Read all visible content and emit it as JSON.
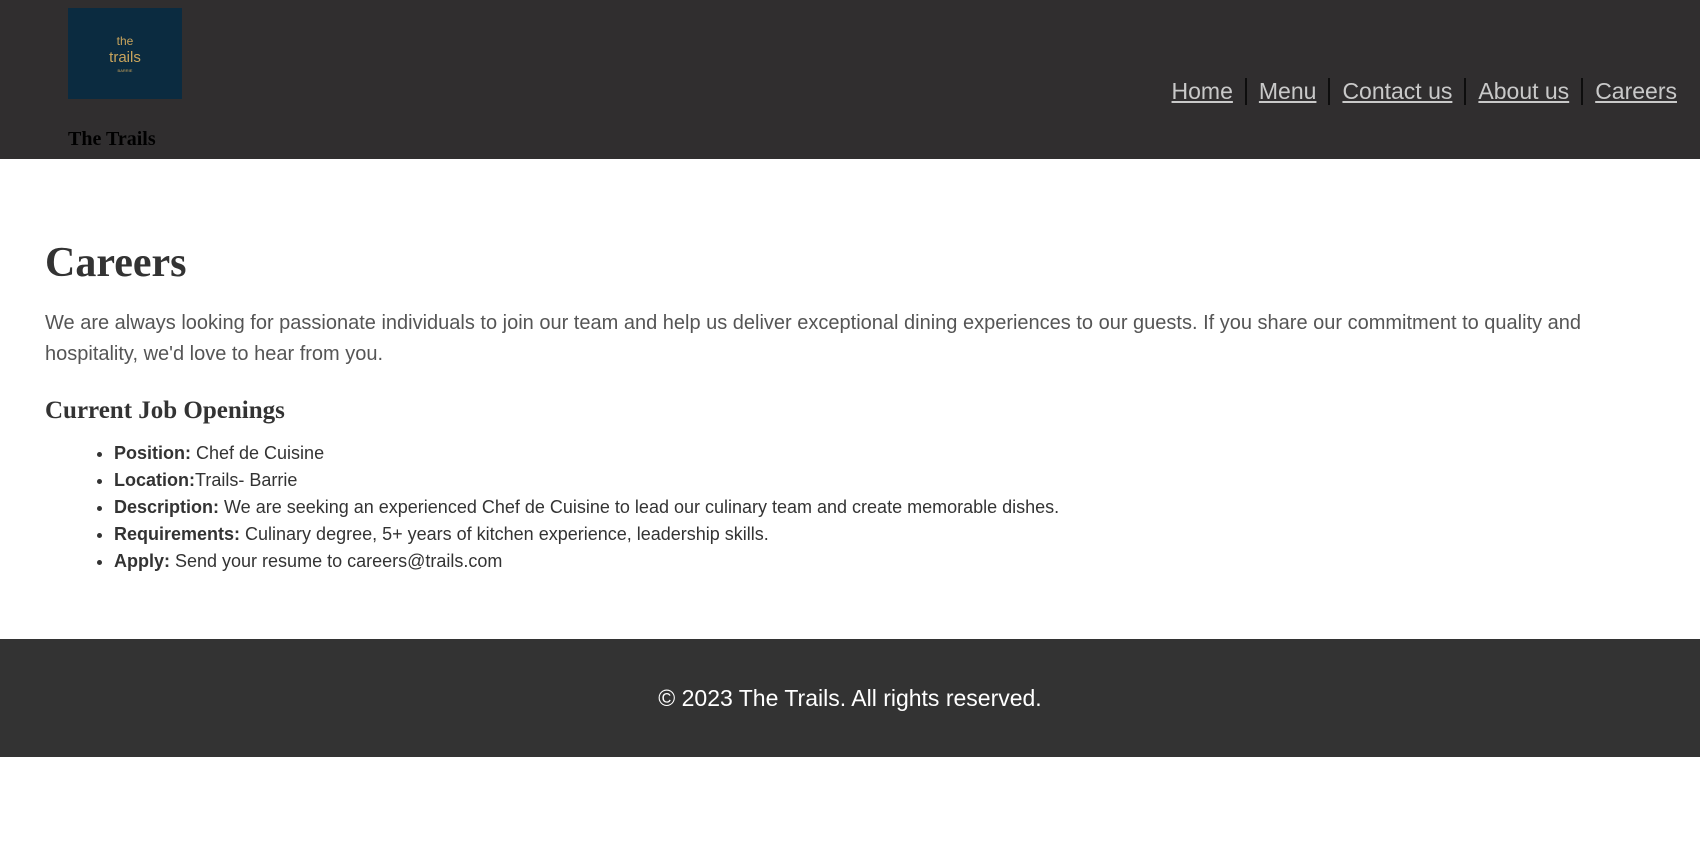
{
  "header": {
    "brand_name": "The Trails",
    "logo_text_top": "the",
    "logo_text_bottom": "trails",
    "logo_tagline": "BARRIE",
    "logo_bg": "#0b2b40",
    "logo_accent": "#c9a45c",
    "nav": [
      {
        "label": "Home"
      },
      {
        "label": "Menu"
      },
      {
        "label": "Contact us"
      },
      {
        "label": "About us"
      },
      {
        "label": "Careers"
      }
    ]
  },
  "main": {
    "title": "Careers",
    "intro": "We are always looking for passionate individuals to join our team and help us deliver exceptional dining experiences to our guests. If you share our commitment to quality and hospitality, we'd love to hear from you.",
    "openings_title": "Current Job Openings",
    "job": [
      {
        "label": "Position:",
        "value": " Chef de Cuisine"
      },
      {
        "label": "Location:",
        "value": "Trails- Barrie"
      },
      {
        "label": "Description:",
        "value": " We are seeking an experienced Chef de Cuisine to lead our culinary team and create memorable dishes."
      },
      {
        "label": "Requirements:",
        "value": " Culinary degree, 5+ years of kitchen experience, leadership skills."
      },
      {
        "label": "Apply:",
        "value": " Send your resume to careers@trails.com"
      }
    ]
  },
  "footer": {
    "text": "© 2023 The Trails. All rights reserved."
  }
}
